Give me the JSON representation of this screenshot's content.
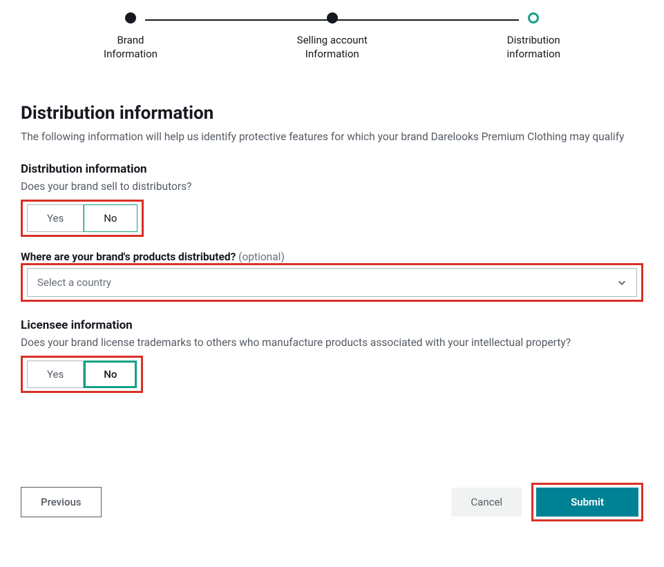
{
  "stepper": {
    "steps": [
      {
        "line1": "Brand",
        "line2": "Information"
      },
      {
        "line1": "Selling account",
        "line2": "Information"
      },
      {
        "line1": "Distribution",
        "line2": "information"
      }
    ]
  },
  "page": {
    "title": "Distribution information",
    "description": "The following information will help us identify protective features for which your brand Darelooks Premium Clothing may qualify"
  },
  "distribution": {
    "heading": "Distribution information",
    "question": "Does your brand sell to distributors?",
    "yes": "Yes",
    "no": "No",
    "countryLabel": "Where are your brand's products distributed?",
    "countryOptional": "(optional)",
    "countryPlaceholder": "Select a country"
  },
  "licensee": {
    "heading": "Licensee information",
    "question": "Does your brand license trademarks to others who manufacture products associated with your intellectual property?",
    "yes": "Yes",
    "no": "No"
  },
  "footer": {
    "previous": "Previous",
    "cancel": "Cancel",
    "submit": "Submit"
  }
}
